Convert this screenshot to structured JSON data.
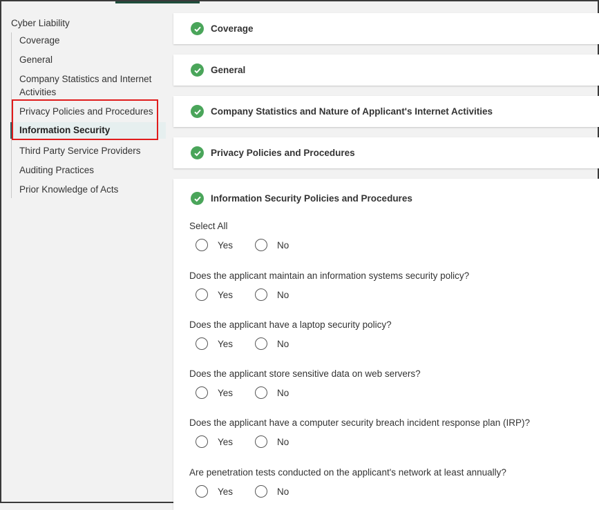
{
  "sidebar": {
    "title": "Cyber Liability",
    "items": [
      {
        "label": "Coverage"
      },
      {
        "label": "General"
      },
      {
        "label": "Company Statistics and Internet Activities"
      },
      {
        "label": "Privacy Policies and Procedures"
      },
      {
        "label": "Information Security",
        "active": true
      },
      {
        "label": "Third Party Service Providers"
      },
      {
        "label": "Auditing Practices"
      },
      {
        "label": "Prior Knowledge of Acts"
      }
    ]
  },
  "sections": [
    {
      "title": "Coverage",
      "status": "complete"
    },
    {
      "title": "General",
      "status": "complete"
    },
    {
      "title": "Company Statistics and Nature of Applicant's Internet Activities",
      "status": "complete"
    },
    {
      "title": "Privacy Policies and Procedures",
      "status": "complete"
    },
    {
      "title": "Information Security Policies and Procedures",
      "status": "complete"
    }
  ],
  "questions": [
    {
      "text": "Select All",
      "yes": "Yes",
      "no": "No"
    },
    {
      "text": "Does the applicant maintain an information systems security policy?",
      "yes": "Yes",
      "no": "No"
    },
    {
      "text": "Does the applicant have a laptop security policy?",
      "yes": "Yes",
      "no": "No"
    },
    {
      "text": "Does the applicant store sensitive data on web servers?",
      "yes": "Yes",
      "no": "No"
    },
    {
      "text": "Does the applicant have a computer security breach incident response plan (IRP)?",
      "yes": "Yes",
      "no": "No"
    },
    {
      "text": "Are penetration tests conducted on the applicant's network at least annually?",
      "yes": "Yes",
      "no": "No"
    }
  ],
  "colors": {
    "check": "#4aa55a",
    "highlight_box": "#e01b1b",
    "active_bg": "#e6efef"
  }
}
